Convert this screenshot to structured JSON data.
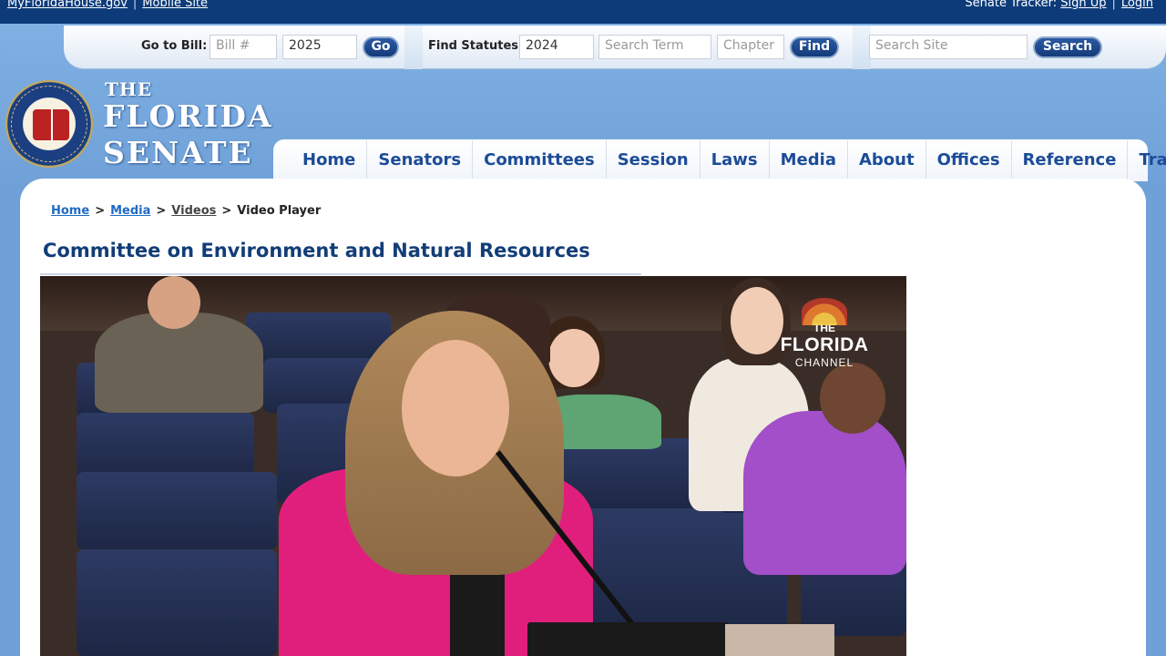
{
  "topbar": {
    "left_link_1": "MyFloridaHouse.gov",
    "left_sep": "|",
    "left_link_2": "Mobile Site",
    "right_label": "Senate Tracker:",
    "right_link_1": "Sign Up",
    "right_sep": "|",
    "right_link_2": "Login"
  },
  "search": {
    "bill_label": "Go to Bill:",
    "bill_placeholder": "Bill #",
    "bill_year": "2025",
    "bill_go": "Go",
    "statutes_label": "Find Statutes:",
    "statutes_year": "2024",
    "term_placeholder": "Search Term",
    "chapter_placeholder": "Chapter",
    "find_button": "Find",
    "site_placeholder": "Search Site",
    "site_button": "Search"
  },
  "brand": {
    "the": "THE",
    "line1": "FLORIDA",
    "line2": "SENATE"
  },
  "nav": {
    "items": [
      "Home",
      "Senators",
      "Committees",
      "Session",
      "Laws",
      "Media",
      "About",
      "Offices",
      "Reference",
      "Tracker"
    ]
  },
  "breadcrumb": {
    "home": "Home",
    "media": "Media",
    "videos": "Videos",
    "current": "Video Player",
    "sep": ">"
  },
  "page": {
    "title": "Committee on Environment and Natural Resources"
  },
  "video": {
    "watermark_the": "THE",
    "watermark_florida": "FLORIDA",
    "watermark_channel": "CHANNEL"
  },
  "colors": {
    "topbar": "#0d3b7a",
    "nav_text": "#1c4c97",
    "title": "#123d78",
    "speaker_jacket": "#e01f7c"
  }
}
